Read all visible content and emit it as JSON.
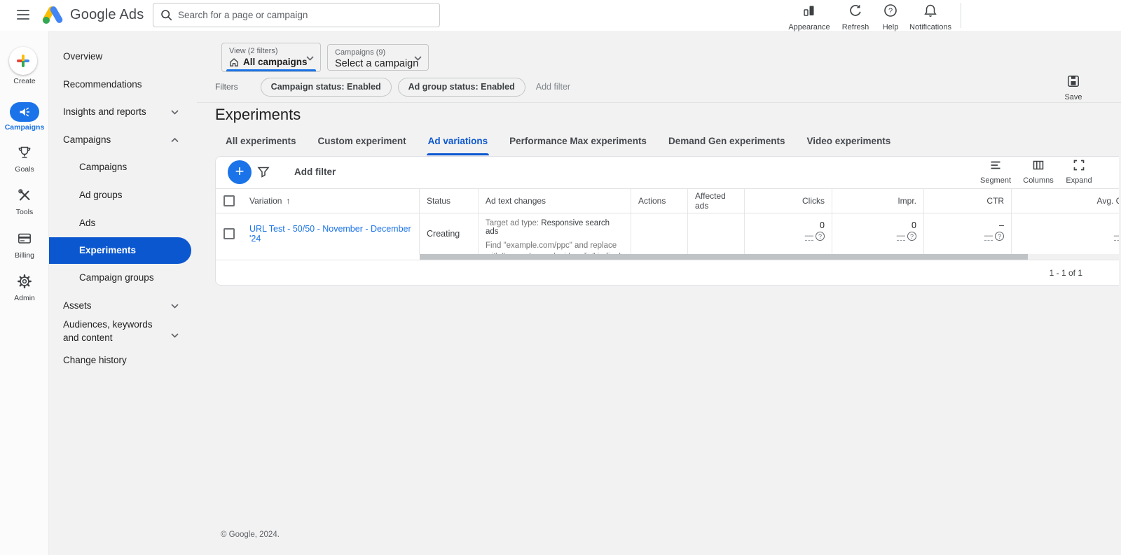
{
  "topbar": {
    "brand": "Google Ads",
    "search": {
      "placeholder": "Search for a page or campaign"
    },
    "actions": [
      {
        "label": "Appearance"
      },
      {
        "label": "Refresh"
      },
      {
        "label": "Help"
      },
      {
        "label": "Notifications"
      }
    ]
  },
  "rail": {
    "items": [
      {
        "label": "Create"
      },
      {
        "label": "Campaigns"
      },
      {
        "label": "Goals"
      },
      {
        "label": "Tools"
      },
      {
        "label": "Billing"
      },
      {
        "label": "Admin"
      }
    ]
  },
  "nav": {
    "items": [
      {
        "label": "Overview"
      },
      {
        "label": "Recommendations"
      },
      {
        "label": "Insights and reports"
      },
      {
        "label": "Campaigns"
      },
      {
        "label": "Campaigns"
      },
      {
        "label": "Ad groups"
      },
      {
        "label": "Ads"
      },
      {
        "label": "Experiments"
      },
      {
        "label": "Campaign groups"
      },
      {
        "label": "Assets"
      },
      {
        "label": "Audiences, keywords and content"
      },
      {
        "label": "Change history"
      }
    ]
  },
  "controls": {
    "view": {
      "label": "View (2 filters)",
      "value": "All campaigns"
    },
    "campaign": {
      "label": "Campaigns (9)",
      "value": "Select a campaign"
    },
    "filters_label": "Filters",
    "chips": [
      "Campaign status: Enabled",
      "Ad group status: Enabled"
    ],
    "add_filter": "Add filter",
    "save": "Save"
  },
  "page": {
    "title": "Experiments",
    "tabs": [
      "All experiments",
      "Custom experiment",
      "Ad variations",
      "Performance Max experiments",
      "Demand Gen experiments",
      "Video experiments"
    ],
    "active_tab": "Ad variations"
  },
  "table": {
    "toolbar": {
      "add_filter": "Add filter",
      "segment": "Segment",
      "columns": "Columns",
      "expand": "Expand"
    },
    "headers": {
      "variation": "Variation",
      "sort_arrow": "↑",
      "status": "Status",
      "ad_text_changes": "Ad text changes",
      "actions": "Actions",
      "affected_ads": "Affected ads",
      "clicks": "Clicks",
      "impr": "Impr.",
      "ctr": "CTR",
      "avg_cpc": "Avg. CPC"
    },
    "row": {
      "variation": "URL Test - 50/50 - November - December '24",
      "status": "Creating",
      "target_label": "Target ad type:",
      "target_value": "Responsive search ads",
      "change_desc": "Find \"example.com/ppc\" and replace with \"example.com/paidmedia\" in final URL",
      "clicks": "0",
      "impr": "0",
      "ctr": "–",
      "avg_cpc": "–",
      "placeholder_dashes": "––",
      "help_glyph": "?"
    },
    "pagination": "1 - 1 of 1"
  },
  "footer": "© Google, 2024.",
  "colors": {
    "accent_blue": "#1a73e8",
    "selected_blue": "#0b57d0"
  }
}
